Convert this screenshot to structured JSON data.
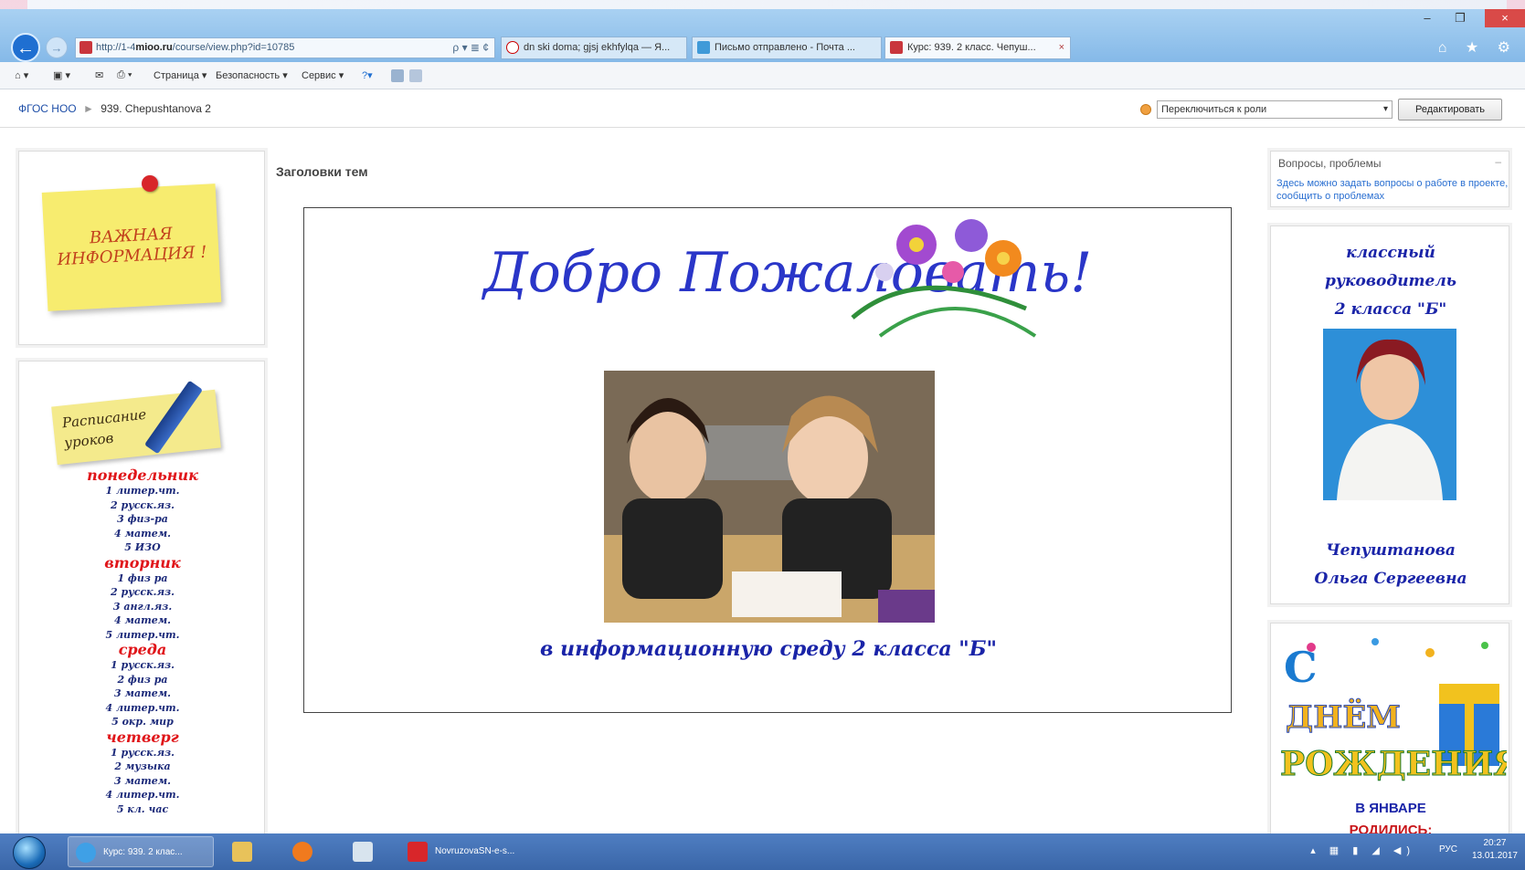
{
  "browser": {
    "address_scheme": "http://1-4",
    "address_domain": "mioo.ru",
    "address_path": "/course/view.php?id=10785",
    "address_tools": "ρ ▾ ≣ ¢",
    "tabs": [
      {
        "label": "dn ski doma; gjsj ekhfylqa — Я..."
      },
      {
        "label": "Письмо отправлено - Почта ..."
      },
      {
        "label": "Курс: 939. 2 класс. Чепуш..."
      }
    ],
    "tab_close": "×",
    "win_minimize": "–",
    "win_restore": "❐",
    "win_close": "×",
    "right_icons": "⌂ ★ ⚙",
    "back_glyph": "←",
    "forward_glyph": "→"
  },
  "command_bar": {
    "page": "Страница ▾",
    "safety": "Безопасность ▾",
    "service": "Сервис ▾",
    "glyph_home": "⌂ ▾",
    "glyph_feeds": "▣ ▾",
    "glyph_mail": "✉",
    "glyph_print": "⎙ ▾",
    "glyph_help": "?▾"
  },
  "breadcrumb": {
    "root": "ФГОС НОО",
    "separator": "►",
    "course": "939. Chepushtanova 2"
  },
  "role_switch": {
    "selected": "Переключиться к роли",
    "caret": "▾",
    "edit_button": "Редактировать"
  },
  "left_blocks": {
    "important_note": [
      "ВАЖНАЯ",
      "ИНФОРМАЦИЯ !"
    ],
    "schedule_note": [
      "Расписание",
      "уроков"
    ],
    "schedule": [
      {
        "day": "понедельник",
        "lessons": [
          "1 литер.чт.",
          "2 русск.яз.",
          "3 физ-ра",
          "4 матем.",
          "5 ИЗО"
        ]
      },
      {
        "day": "вторник",
        "lessons": [
          "1 физ ра",
          "2 русск.яз.",
          "3 англ.яз.",
          "4 матем.",
          "5 литер.чт."
        ]
      },
      {
        "day": "среда",
        "lessons": [
          "1 русск.яз.",
          "2 физ ра",
          "3 матем.",
          "4 литер.чт.",
          "5 окр. мир"
        ]
      },
      {
        "day": "четверг",
        "lessons": [
          "1 русск.яз.",
          "2 музыка",
          "3 матем.",
          "4 литер.чт.",
          "5 кл. час"
        ]
      }
    ]
  },
  "main": {
    "heading": "Заголовки тем",
    "welcome": "Добро Пожаловать!",
    "subtitle": "в информационную среду 2 класса \"Б\""
  },
  "right_blocks": {
    "questions": {
      "title": "Вопросы, проблемы",
      "collapse": "–",
      "text": "Здесь можно задать вопросы о работе в проекте, сообщить о проблемах"
    },
    "teacher": {
      "role_lines": [
        "классный",
        "руководитель",
        "2 класса \"Б\""
      ],
      "name_lines": [
        "Чепуштанова",
        "Ольга Сергеевна"
      ]
    },
    "birthday": {
      "art_lines": [
        "С",
        "ДНЁМ",
        "РОЖДЕНИЯ!"
      ],
      "label": "В ЯНВАРЕ",
      "sub": "РОДИЛИСЬ:"
    }
  },
  "taskbar": {
    "items": [
      {
        "label": "Курс: 939. 2 клас..."
      },
      {
        "label": ""
      },
      {
        "label": ""
      },
      {
        "label": ""
      },
      {
        "label": "NovruzovaSN-e-s..."
      }
    ],
    "tray_icons": "▴ ▦ ▮ ◢ ◀)",
    "lang": "РУС",
    "time": "20:27",
    "date": "13.01.2017"
  },
  "colors": {
    "schedule_day": "#e0161a",
    "schedule_lesson": "#1c2a7a",
    "accent_blue": "#1a24a8",
    "link": "#2a6fd1"
  }
}
